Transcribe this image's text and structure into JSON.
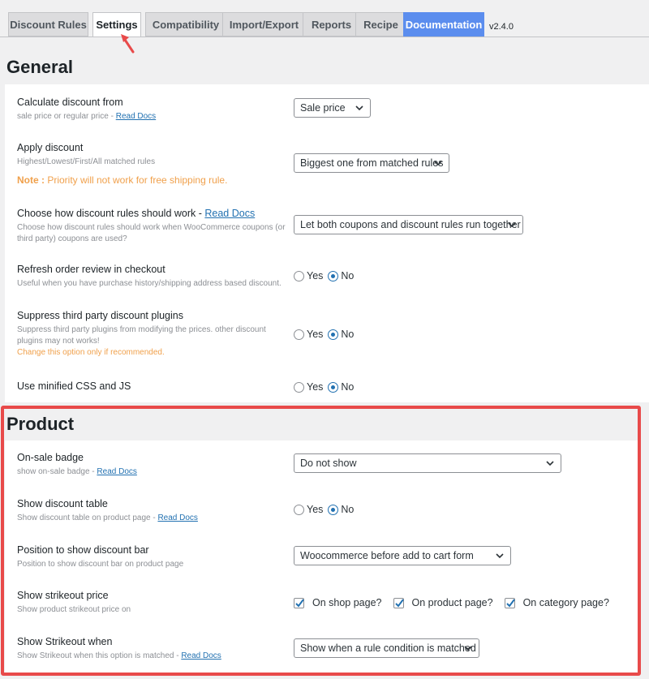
{
  "tabs": [
    {
      "label": "Discount Rules"
    },
    {
      "label": "Settings"
    },
    {
      "label": "Compatibility"
    },
    {
      "label": "Import/Export"
    },
    {
      "label": "Reports"
    },
    {
      "label": "Recipe"
    },
    {
      "label": "Documentation"
    }
  ],
  "version": "v2.4.0",
  "general": {
    "title": "General",
    "calc": {
      "label": "Calculate discount from",
      "desc": "sale price or regular price - ",
      "link": "Read Docs",
      "value": "Sale price"
    },
    "apply": {
      "label": "Apply discount",
      "desc": "Highest/Lowest/First/All matched rules",
      "note_prefix": "Note :",
      "note_text": " Priority will not work for free shipping rule.",
      "value": "Biggest one from matched rules"
    },
    "how": {
      "label": "Choose how discount rules should work - ",
      "link": "Read Docs",
      "desc_line1": "Choose how discount rules should work when WooCommerce coupons (or",
      "desc_line2": "third party) coupons are used?",
      "value": "Let both coupons and discount rules run together"
    },
    "refresh": {
      "label": "Refresh order review in checkout",
      "desc": "Useful when you have purchase history/shipping address based discount.",
      "yes": "Yes",
      "no": "No",
      "selected": "No"
    },
    "suppress": {
      "label": "Suppress third party discount plugins",
      "desc_line1": "Suppress third party plugins from modifying the prices. other discount",
      "desc_line2": "plugins may not works!",
      "warning": "Change this option only if recommended.",
      "yes": "Yes",
      "no": "No",
      "selected": "No"
    },
    "minified": {
      "label": "Use minified CSS and JS",
      "yes": "Yes",
      "no": "No",
      "selected": "No"
    }
  },
  "product": {
    "title": "Product",
    "badge": {
      "label": "On-sale badge",
      "desc": "show on-sale badge - ",
      "link": "Read Docs",
      "value": "Do not show"
    },
    "table": {
      "label": "Show discount table",
      "desc": "Show discount table on product page - ",
      "link": "Read Docs",
      "yes": "Yes",
      "no": "No",
      "selected": "No"
    },
    "bar": {
      "label": "Position to show discount bar",
      "desc": "Position to show discount bar on product page",
      "value": "Woocommerce before add to cart form"
    },
    "strike": {
      "label": "Show strikeout price",
      "desc": "Show product strikeout price on",
      "options": [
        "On shop page?",
        "On product page?",
        "On category page?"
      ],
      "checked": [
        true,
        true,
        true
      ]
    },
    "strike_when": {
      "label": "Show Strikeout when",
      "desc": "Show Strikeout when this option is matched - ",
      "link": "Read Docs",
      "value": "Show when a rule condition is matched"
    }
  },
  "colors": {
    "accent": "#2271b1",
    "documentation_tab": "#5b8dee",
    "note": "#f0a04b",
    "highlight": "#e84a4a",
    "arrow": "#e84a4a"
  }
}
